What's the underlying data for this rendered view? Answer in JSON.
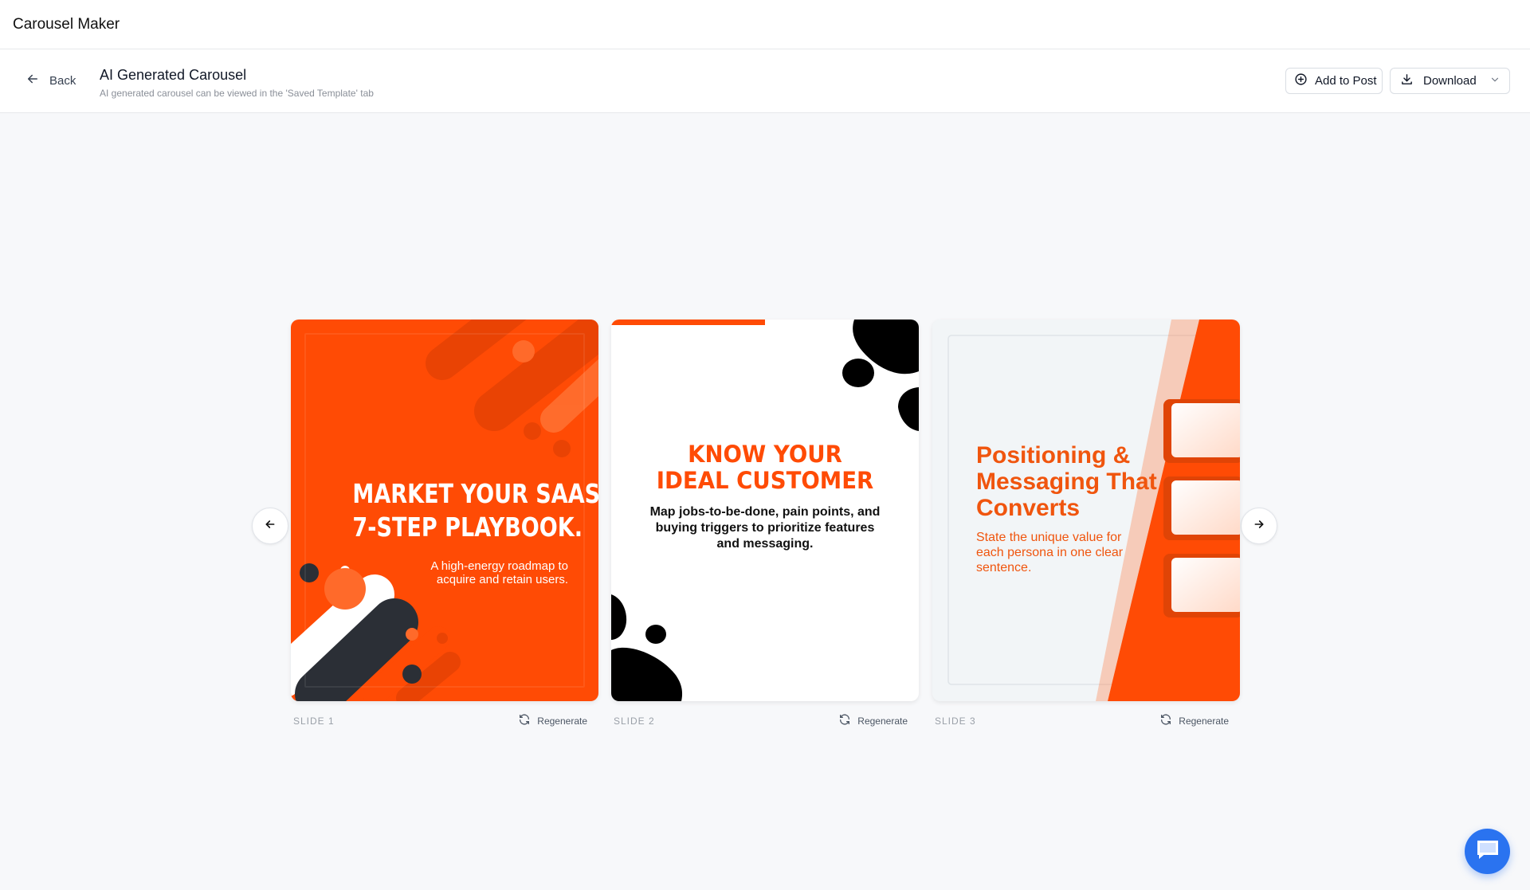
{
  "app": {
    "title": "Carousel Maker"
  },
  "toolbar": {
    "back_label": "Back",
    "title": "AI Generated Carousel",
    "subtitle": "AI generated carousel can be viewed in the 'Saved Template' tab",
    "add_to_post_label": "Add to Post",
    "download_label": "Download"
  },
  "slides": [
    {
      "label": "SLIDE 1",
      "regenerate_label": "Regenerate",
      "heading_line1": "MARKET YOUR SAAS:",
      "heading_line2": "7-STEP PLAYBOOK.",
      "subheading_line1": "A high-energy roadmap to",
      "subheading_line2": "acquire and retain users."
    },
    {
      "label": "SLIDE 2",
      "regenerate_label": "Regenerate",
      "heading_line1": "KNOW YOUR",
      "heading_line2": "IDEAL CUSTOMER",
      "body": "Map jobs-to-be-done, pain points, and buying triggers to prioritize features and messaging."
    },
    {
      "label": "SLIDE 3",
      "regenerate_label": "Regenerate",
      "heading": "Positioning & Messaging That Converts",
      "body": "State the unique value for each persona in one clear sentence."
    }
  ],
  "colors": {
    "accent_orange": "#ff4b05",
    "dark_shape": "#2b2f36",
    "chat_button": "#2a73f0"
  },
  "icons": {
    "back": "arrow-left-icon",
    "add_to_post": "plus-circle-icon",
    "download": "download-icon",
    "dropdown": "chevron-down-icon",
    "prev": "arrow-left-icon",
    "next": "arrow-right-icon",
    "regenerate": "refresh-icon",
    "chat": "chat-icon"
  }
}
